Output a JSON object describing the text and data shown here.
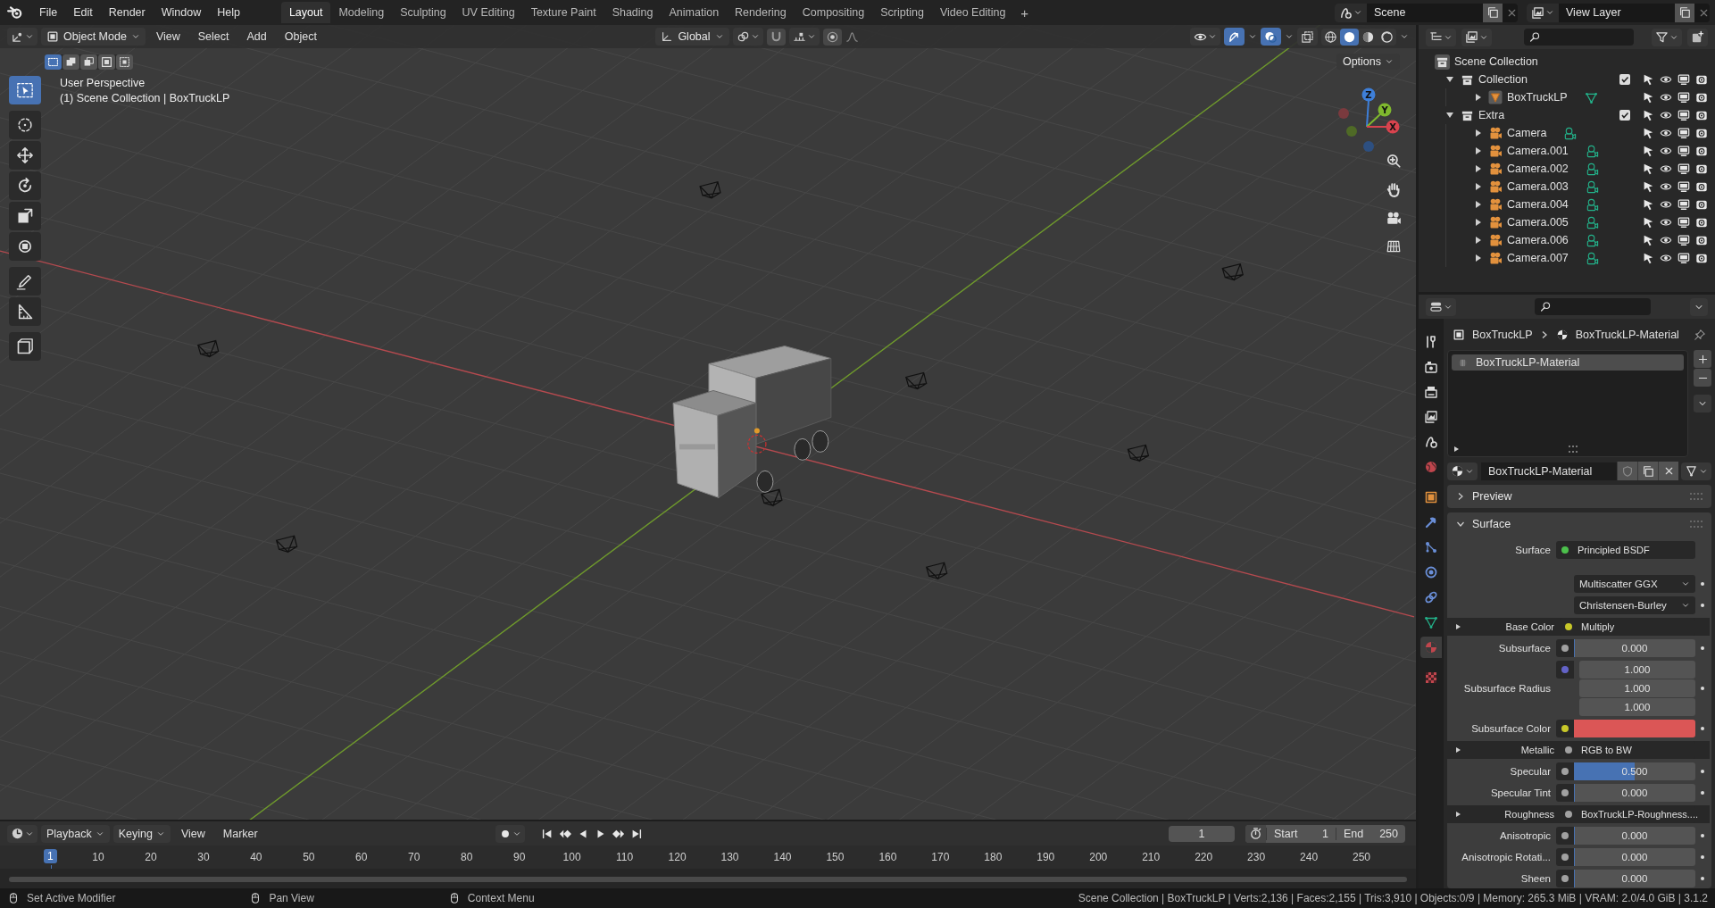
{
  "topbar": {
    "menus": [
      "File",
      "Edit",
      "Render",
      "Window",
      "Help"
    ],
    "workspaces": [
      {
        "label": "Layout",
        "selected": true
      },
      {
        "label": "Modeling",
        "selected": false
      },
      {
        "label": "Sculpting",
        "selected": false
      },
      {
        "label": "UV Editing",
        "selected": false
      },
      {
        "label": "Texture Paint",
        "selected": false
      },
      {
        "label": "Shading",
        "selected": false
      },
      {
        "label": "Animation",
        "selected": false
      },
      {
        "label": "Rendering",
        "selected": false
      },
      {
        "label": "Compositing",
        "selected": false
      },
      {
        "label": "Scripting",
        "selected": false
      },
      {
        "label": "Video Editing",
        "selected": false
      }
    ],
    "add_workspace": "+",
    "scene": "Scene",
    "view_layer": "View Layer"
  },
  "viewport": {
    "mode": "Object Mode",
    "menus": [
      "View",
      "Select",
      "Add",
      "Object"
    ],
    "orientation": "Global",
    "options": "Options",
    "select_modes": [
      {
        "kind": "new",
        "selected": true
      },
      {
        "kind": "extend",
        "selected": false
      },
      {
        "kind": "subtract",
        "selected": false
      },
      {
        "kind": "invert",
        "selected": false
      },
      {
        "kind": "intersect",
        "selected": false
      }
    ],
    "shading": [
      {
        "kind": "wireframe",
        "selected": false
      },
      {
        "kind": "solid",
        "selected": true
      },
      {
        "kind": "material",
        "selected": false
      },
      {
        "kind": "rendered",
        "selected": false
      }
    ],
    "info": [
      "User Perspective",
      "(1) Scene Collection | BoxTruckLP"
    ],
    "tools": [
      {
        "kind": "select",
        "selected": true
      },
      {
        "kind": "cursor",
        "selected": false
      },
      {
        "kind": "move",
        "selected": false
      },
      {
        "kind": "rotate",
        "selected": false
      },
      {
        "kind": "scale",
        "selected": false
      },
      {
        "kind": "transform",
        "selected": false
      },
      {
        "kind": "annotate",
        "selected": false
      },
      {
        "kind": "measure",
        "selected": false
      },
      {
        "kind": "add_cube",
        "selected": false
      }
    ],
    "gizmo_axes": [
      "X",
      "Y",
      "Z"
    ]
  },
  "outliner": {
    "root": "Scene Collection",
    "items": [
      {
        "name": "Collection",
        "kind": "collection",
        "expanded": true,
        "checked": true,
        "children": [
          {
            "name": "BoxTruckLP",
            "kind": "mesh",
            "expanded": false
          }
        ]
      },
      {
        "name": "Extra",
        "kind": "collection",
        "expanded": true,
        "checked": true,
        "children": [
          {
            "name": "Camera",
            "kind": "camera",
            "expanded": false
          },
          {
            "name": "Camera.001",
            "kind": "camera",
            "expanded": false
          },
          {
            "name": "Camera.002",
            "kind": "camera",
            "expanded": false
          },
          {
            "name": "Camera.003",
            "kind": "camera",
            "expanded": false
          },
          {
            "name": "Camera.004",
            "kind": "camera",
            "expanded": false
          },
          {
            "name": "Camera.005",
            "kind": "camera",
            "expanded": false
          },
          {
            "name": "Camera.006",
            "kind": "camera",
            "expanded": false
          },
          {
            "name": "Camera.007",
            "kind": "camera",
            "expanded": false
          }
        ]
      }
    ]
  },
  "properties": {
    "tabs": [
      {
        "kind": "tool",
        "selected": false
      },
      {
        "kind": "render",
        "selected": false
      },
      {
        "kind": "output",
        "selected": false
      },
      {
        "kind": "view_layer",
        "selected": false
      },
      {
        "kind": "scene",
        "selected": false
      },
      {
        "kind": "world",
        "selected": false
      },
      {
        "kind": "object",
        "selected": false
      },
      {
        "kind": "modifiers",
        "selected": false
      },
      {
        "kind": "particles",
        "selected": false
      },
      {
        "kind": "physics",
        "selected": false
      },
      {
        "kind": "constraints",
        "selected": false
      },
      {
        "kind": "data",
        "selected": false
      },
      {
        "kind": "material",
        "selected": true
      },
      {
        "kind": "texture",
        "selected": false
      }
    ],
    "breadcrumb": [
      "BoxTruckLP",
      "BoxTruckLP-Material"
    ],
    "slots": [
      {
        "name": "BoxTruckLP-Material",
        "selected": true
      }
    ],
    "material": "BoxTruckLP-Material",
    "panels": [
      {
        "title": "Preview",
        "expanded": false
      },
      {
        "title": "Surface",
        "expanded": true
      }
    ],
    "rows": [
      {
        "kind": "shader",
        "label": "Surface",
        "value": "Principled BSDF",
        "color": "#4cc04c"
      },
      {
        "kind": "dropdown",
        "value": "Multiscatter GGX"
      },
      {
        "kind": "dropdown",
        "value": "Christensen-Burley"
      },
      {
        "kind": "link",
        "label": "Base Color",
        "value": "Multiply",
        "color": "#c7c729",
        "expanded": false
      },
      {
        "kind": "number",
        "label": "Subsurface",
        "value": "0.000",
        "level": 0,
        "color": "#a1a1a1"
      },
      {
        "kind": "vector",
        "label": "Subsurface Radius",
        "values": [
          "1.000",
          "1.000",
          "1.000"
        ],
        "color": "#6363c7"
      },
      {
        "kind": "color",
        "label": "Subsurface Color",
        "swatch": {
          "color": "#db5656"
        },
        "color": "#c7c729"
      },
      {
        "kind": "link",
        "label": "Metallic",
        "value": "RGB to BW",
        "color": "#a1a1a1",
        "expanded": false
      },
      {
        "kind": "number",
        "label": "Specular",
        "value": "0.500",
        "level": 0.5,
        "color": "#a1a1a1"
      },
      {
        "kind": "number",
        "label": "Specular Tint",
        "value": "0.000",
        "level": 0,
        "color": "#a1a1a1"
      },
      {
        "kind": "link",
        "label": "Roughness",
        "value": "BoxTruckLP-Roughness....",
        "color": "#a1a1a1",
        "expanded": false
      },
      {
        "kind": "number",
        "label": "Anisotropic",
        "value": "0.000",
        "level": 0,
        "color": "#a1a1a1"
      },
      {
        "kind": "number",
        "label": "Anisotropic Rotati...",
        "value": "0.000",
        "level": 0,
        "color": "#a1a1a1"
      },
      {
        "kind": "number",
        "label": "Sheen",
        "value": "0.000",
        "level": 0,
        "color": "#a1a1a1"
      }
    ]
  },
  "timeline": {
    "menus": [
      "Playback",
      "Keying",
      "View",
      "Marker"
    ],
    "auto_keying": false,
    "current_frame": "1",
    "start_label": "Start",
    "start": "1",
    "end_label": "End",
    "end": "250",
    "playhead": "1",
    "ticks": [
      "10",
      "20",
      "30",
      "40",
      "50",
      "60",
      "70",
      "80",
      "90",
      "100",
      "110",
      "120",
      "130",
      "140",
      "150",
      "160",
      "170",
      "180",
      "190",
      "200",
      "210",
      "220",
      "230",
      "240",
      "250"
    ]
  },
  "status": {
    "hints": [
      "Set Active Modifier",
      "Pan View",
      "Context Menu"
    ],
    "stats": "Scene Collection | BoxTruckLP | Verts:2,136 | Faces:2,155 | Tris:3,910 | Objects:0/9 | Memory: 265.3 MiB | VRAM: 2.0/4.0 GiB | 3.1.2"
  }
}
